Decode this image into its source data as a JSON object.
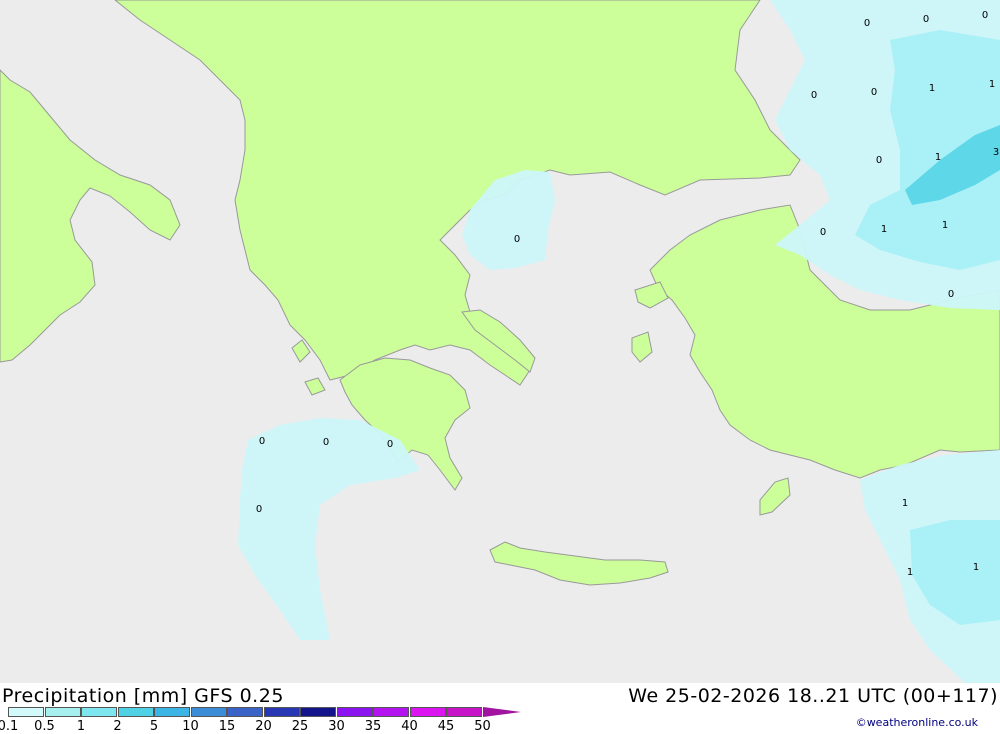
{
  "title": "Precipitation [mm] GFS 0.25",
  "valid_time": "We 25-02-2026 18..21 UTC (00+117)",
  "credit": "©weatheronline.co.uk",
  "colors": {
    "sea": "#ececec",
    "land": "#ccff99",
    "coast": "#999999",
    "precip_light": "#ccf7fa",
    "precip_mid": "#a6f0f5",
    "precip_heavy": "#55d4e8"
  },
  "legend": {
    "ticks": [
      "0.1",
      "0.5",
      "1",
      "2",
      "5",
      "10",
      "15",
      "20",
      "25",
      "30",
      "35",
      "40",
      "45",
      "50"
    ],
    "colors": [
      "#d2fafa",
      "#a6f0f0",
      "#7ee6ee",
      "#50d2e6",
      "#3cb4e6",
      "#3c8cd8",
      "#3c64c8",
      "#2838b4",
      "#14148c",
      "#8c14f0",
      "#b414f0",
      "#dc14f0",
      "#c814c8",
      "#a014a0"
    ]
  },
  "point_labels": [
    "0",
    "0",
    "0",
    "0",
    "1",
    "1",
    "0",
    "1",
    "3",
    "0",
    "1",
    "1",
    "0",
    "0",
    "0",
    "0",
    "0",
    "0",
    "0",
    "1",
    "1",
    "1"
  ]
}
